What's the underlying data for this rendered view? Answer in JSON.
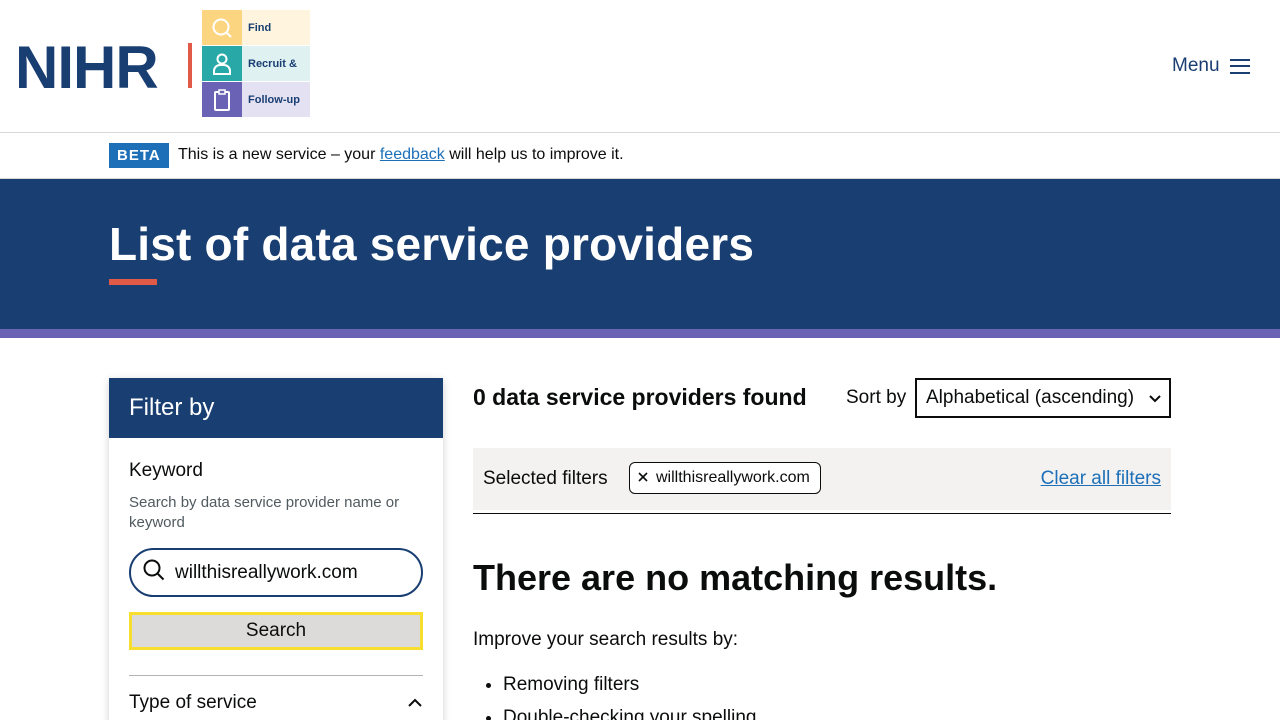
{
  "header": {
    "logo_text": "NIHR",
    "tiles": [
      {
        "icon": "search-icon",
        "label": "Find"
      },
      {
        "icon": "person-icon",
        "label": "Recruit &"
      },
      {
        "icon": "clipboard-icon",
        "label": "Follow-up"
      }
    ],
    "menu_label": "Menu"
  },
  "beta": {
    "tag": "BETA",
    "text_before": "This is a new service – your ",
    "link": "feedback",
    "text_after": " will help us to improve it."
  },
  "hero": {
    "title": "List of data service providers"
  },
  "filter": {
    "heading": "Filter by",
    "keyword_label": "Keyword",
    "keyword_hint": "Search by data service provider name or keyword",
    "keyword_value": "willthisreallywork.com",
    "search_button": "Search",
    "type_of_service": "Type of service"
  },
  "results": {
    "count_text": "0 data service providers found",
    "sort_label": "Sort by",
    "sort_selected": "Alphabetical (ascending)",
    "selected_filters_label": "Selected filters",
    "chips": [
      "willthisreallywork.com"
    ],
    "clear_all": "Clear all filters",
    "no_results_heading": "There are no matching results.",
    "improve_text": "Improve your search results by:",
    "tips": [
      "Removing filters",
      "Double-checking your spelling"
    ]
  },
  "colors": {
    "navy": "#193e72",
    "accent_red": "#e05a47",
    "purple_strip": "#6a62b4",
    "link_blue": "#1d70b8",
    "focus_yellow": "#f8de2e"
  }
}
